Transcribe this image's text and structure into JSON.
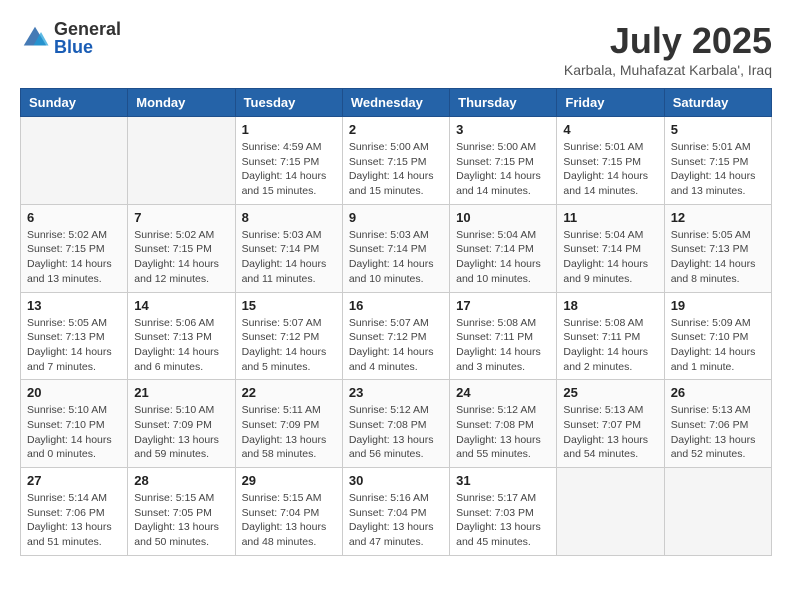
{
  "header": {
    "logo_general": "General",
    "logo_blue": "Blue",
    "month_year": "July 2025",
    "location": "Karbala, Muhafazat Karbala', Iraq"
  },
  "weekdays": [
    "Sunday",
    "Monday",
    "Tuesday",
    "Wednesday",
    "Thursday",
    "Friday",
    "Saturday"
  ],
  "weeks": [
    [
      {
        "day": "",
        "empty": true
      },
      {
        "day": "",
        "empty": true
      },
      {
        "day": "1",
        "sunrise": "Sunrise: 4:59 AM",
        "sunset": "Sunset: 7:15 PM",
        "daylight": "Daylight: 14 hours and 15 minutes."
      },
      {
        "day": "2",
        "sunrise": "Sunrise: 5:00 AM",
        "sunset": "Sunset: 7:15 PM",
        "daylight": "Daylight: 14 hours and 15 minutes."
      },
      {
        "day": "3",
        "sunrise": "Sunrise: 5:00 AM",
        "sunset": "Sunset: 7:15 PM",
        "daylight": "Daylight: 14 hours and 14 minutes."
      },
      {
        "day": "4",
        "sunrise": "Sunrise: 5:01 AM",
        "sunset": "Sunset: 7:15 PM",
        "daylight": "Daylight: 14 hours and 14 minutes."
      },
      {
        "day": "5",
        "sunrise": "Sunrise: 5:01 AM",
        "sunset": "Sunset: 7:15 PM",
        "daylight": "Daylight: 14 hours and 13 minutes."
      }
    ],
    [
      {
        "day": "6",
        "sunrise": "Sunrise: 5:02 AM",
        "sunset": "Sunset: 7:15 PM",
        "daylight": "Daylight: 14 hours and 13 minutes."
      },
      {
        "day": "7",
        "sunrise": "Sunrise: 5:02 AM",
        "sunset": "Sunset: 7:15 PM",
        "daylight": "Daylight: 14 hours and 12 minutes."
      },
      {
        "day": "8",
        "sunrise": "Sunrise: 5:03 AM",
        "sunset": "Sunset: 7:14 PM",
        "daylight": "Daylight: 14 hours and 11 minutes."
      },
      {
        "day": "9",
        "sunrise": "Sunrise: 5:03 AM",
        "sunset": "Sunset: 7:14 PM",
        "daylight": "Daylight: 14 hours and 10 minutes."
      },
      {
        "day": "10",
        "sunrise": "Sunrise: 5:04 AM",
        "sunset": "Sunset: 7:14 PM",
        "daylight": "Daylight: 14 hours and 10 minutes."
      },
      {
        "day": "11",
        "sunrise": "Sunrise: 5:04 AM",
        "sunset": "Sunset: 7:14 PM",
        "daylight": "Daylight: 14 hours and 9 minutes."
      },
      {
        "day": "12",
        "sunrise": "Sunrise: 5:05 AM",
        "sunset": "Sunset: 7:13 PM",
        "daylight": "Daylight: 14 hours and 8 minutes."
      }
    ],
    [
      {
        "day": "13",
        "sunrise": "Sunrise: 5:05 AM",
        "sunset": "Sunset: 7:13 PM",
        "daylight": "Daylight: 14 hours and 7 minutes."
      },
      {
        "day": "14",
        "sunrise": "Sunrise: 5:06 AM",
        "sunset": "Sunset: 7:13 PM",
        "daylight": "Daylight: 14 hours and 6 minutes."
      },
      {
        "day": "15",
        "sunrise": "Sunrise: 5:07 AM",
        "sunset": "Sunset: 7:12 PM",
        "daylight": "Daylight: 14 hours and 5 minutes."
      },
      {
        "day": "16",
        "sunrise": "Sunrise: 5:07 AM",
        "sunset": "Sunset: 7:12 PM",
        "daylight": "Daylight: 14 hours and 4 minutes."
      },
      {
        "day": "17",
        "sunrise": "Sunrise: 5:08 AM",
        "sunset": "Sunset: 7:11 PM",
        "daylight": "Daylight: 14 hours and 3 minutes."
      },
      {
        "day": "18",
        "sunrise": "Sunrise: 5:08 AM",
        "sunset": "Sunset: 7:11 PM",
        "daylight": "Daylight: 14 hours and 2 minutes."
      },
      {
        "day": "19",
        "sunrise": "Sunrise: 5:09 AM",
        "sunset": "Sunset: 7:10 PM",
        "daylight": "Daylight: 14 hours and 1 minute."
      }
    ],
    [
      {
        "day": "20",
        "sunrise": "Sunrise: 5:10 AM",
        "sunset": "Sunset: 7:10 PM",
        "daylight": "Daylight: 14 hours and 0 minutes."
      },
      {
        "day": "21",
        "sunrise": "Sunrise: 5:10 AM",
        "sunset": "Sunset: 7:09 PM",
        "daylight": "Daylight: 13 hours and 59 minutes."
      },
      {
        "day": "22",
        "sunrise": "Sunrise: 5:11 AM",
        "sunset": "Sunset: 7:09 PM",
        "daylight": "Daylight: 13 hours and 58 minutes."
      },
      {
        "day": "23",
        "sunrise": "Sunrise: 5:12 AM",
        "sunset": "Sunset: 7:08 PM",
        "daylight": "Daylight: 13 hours and 56 minutes."
      },
      {
        "day": "24",
        "sunrise": "Sunrise: 5:12 AM",
        "sunset": "Sunset: 7:08 PM",
        "daylight": "Daylight: 13 hours and 55 minutes."
      },
      {
        "day": "25",
        "sunrise": "Sunrise: 5:13 AM",
        "sunset": "Sunset: 7:07 PM",
        "daylight": "Daylight: 13 hours and 54 minutes."
      },
      {
        "day": "26",
        "sunrise": "Sunrise: 5:13 AM",
        "sunset": "Sunset: 7:06 PM",
        "daylight": "Daylight: 13 hours and 52 minutes."
      }
    ],
    [
      {
        "day": "27",
        "sunrise": "Sunrise: 5:14 AM",
        "sunset": "Sunset: 7:06 PM",
        "daylight": "Daylight: 13 hours and 51 minutes."
      },
      {
        "day": "28",
        "sunrise": "Sunrise: 5:15 AM",
        "sunset": "Sunset: 7:05 PM",
        "daylight": "Daylight: 13 hours and 50 minutes."
      },
      {
        "day": "29",
        "sunrise": "Sunrise: 5:15 AM",
        "sunset": "Sunset: 7:04 PM",
        "daylight": "Daylight: 13 hours and 48 minutes."
      },
      {
        "day": "30",
        "sunrise": "Sunrise: 5:16 AM",
        "sunset": "Sunset: 7:04 PM",
        "daylight": "Daylight: 13 hours and 47 minutes."
      },
      {
        "day": "31",
        "sunrise": "Sunrise: 5:17 AM",
        "sunset": "Sunset: 7:03 PM",
        "daylight": "Daylight: 13 hours and 45 minutes."
      },
      {
        "day": "",
        "empty": true
      },
      {
        "day": "",
        "empty": true
      }
    ]
  ]
}
